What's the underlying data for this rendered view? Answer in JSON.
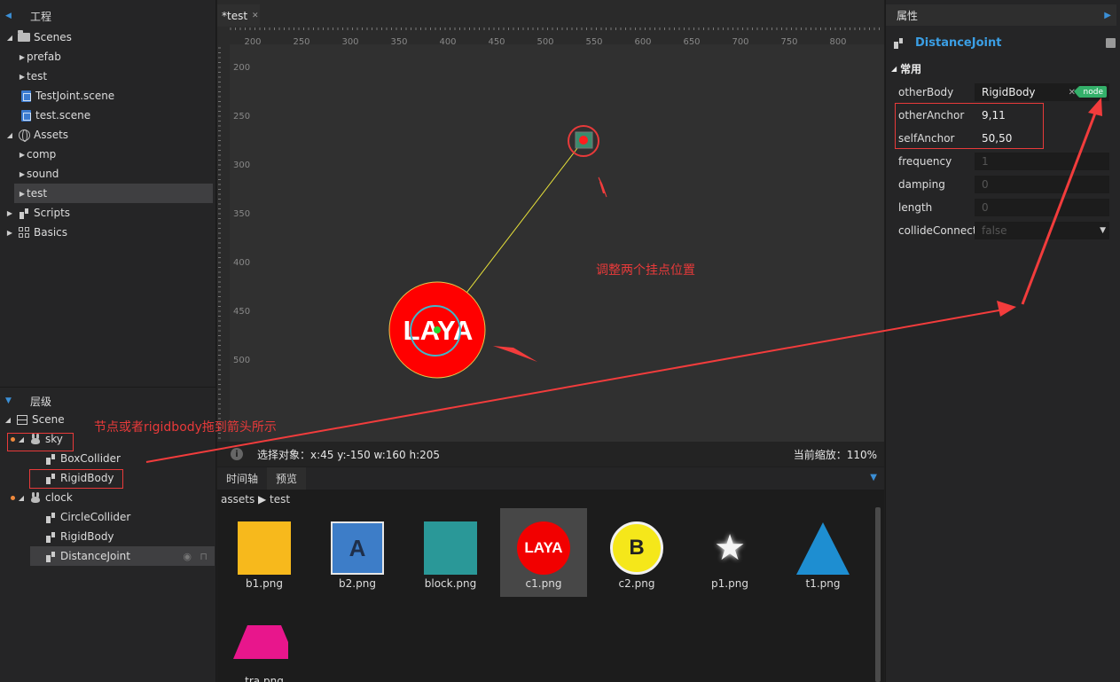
{
  "project_panel": {
    "title": "工程",
    "items": [
      {
        "label": "Scenes"
      },
      {
        "label": "prefab"
      },
      {
        "label": "test"
      },
      {
        "label": "TestJoint.scene"
      },
      {
        "label": "test.scene"
      },
      {
        "label": "Assets"
      },
      {
        "label": "comp"
      },
      {
        "label": "sound"
      },
      {
        "label": "test"
      },
      {
        "label": "Scripts"
      },
      {
        "label": "Basics"
      }
    ]
  },
  "hierarchy_panel": {
    "title": "层级",
    "items": [
      {
        "label": "Scene"
      },
      {
        "label": "sky"
      },
      {
        "label": "BoxCollider"
      },
      {
        "label": "RigidBody"
      },
      {
        "label": "clock"
      },
      {
        "label": "CircleCollider"
      },
      {
        "label": "RigidBody"
      },
      {
        "label": "DistanceJoint"
      }
    ]
  },
  "editor": {
    "tab_label": "*test",
    "ruler_x": [
      "200",
      "250",
      "300",
      "350",
      "400",
      "450",
      "500",
      "550",
      "600",
      "650",
      "700",
      "750",
      "800",
      "8"
    ],
    "ruler_y": [
      "200",
      "250",
      "300",
      "350",
      "400",
      "450",
      "500"
    ],
    "sprite_text": "LAYA",
    "status_text": "选择对象：x:45 y:-150  w:160 h:205",
    "zoom_text": "当前缩放：110%"
  },
  "lower_panel": {
    "tabs": [
      "时间轴",
      "预览"
    ],
    "breadcrumb": "assets ▶ test",
    "assets": [
      {
        "name": "b1.png",
        "label": ""
      },
      {
        "name": "b2.png",
        "label": "A"
      },
      {
        "name": "block.png",
        "label": ""
      },
      {
        "name": "c1.png",
        "label": "LAYA"
      },
      {
        "name": "c2.png",
        "label": "B"
      },
      {
        "name": "p1.png",
        "label": ""
      },
      {
        "name": "t1.png",
        "label": ""
      },
      {
        "name": "tra.png",
        "label": ""
      }
    ]
  },
  "properties_panel": {
    "tab": "属性",
    "component": "DistanceJoint",
    "section": "常用",
    "rows": [
      {
        "name": "otherBody",
        "value": "RigidBody",
        "badge": "node"
      },
      {
        "name": "otherAnchor",
        "value": "9,11"
      },
      {
        "name": "selfAnchor",
        "value": "50,50"
      },
      {
        "name": "frequency",
        "value": "1"
      },
      {
        "name": "damping",
        "value": "0"
      },
      {
        "name": "length",
        "value": "0"
      },
      {
        "name": "collideConnect",
        "value": "false"
      }
    ]
  },
  "annotations": {
    "anchors_note": "调整两个挂点位置",
    "drag_note": "节点或者rigidbody拖到箭头所示"
  },
  "colors": {
    "accent_blue": "#3b9fe5",
    "annotation_red": "#e83a3a",
    "node_badge": "#34b06a"
  }
}
